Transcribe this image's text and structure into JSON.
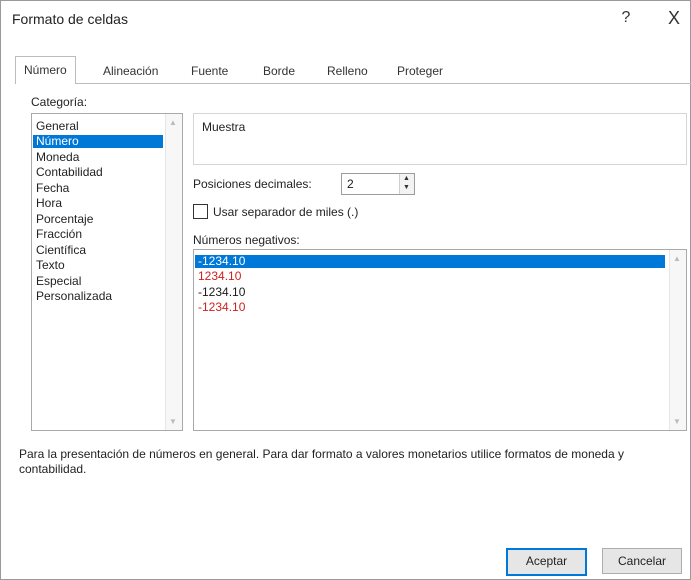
{
  "window": {
    "title": "Formato de celdas",
    "help": "?",
    "close": "X"
  },
  "tabs": [
    {
      "label": "Número",
      "active": true
    },
    {
      "label": "Alineación"
    },
    {
      "label": "Fuente"
    },
    {
      "label": "Borde"
    },
    {
      "label": "Relleno"
    },
    {
      "label": "Proteger"
    }
  ],
  "category": {
    "label": "Categoría:",
    "items": [
      "General",
      "Número",
      "Moneda",
      "Contabilidad",
      "Fecha",
      "Hora",
      "Porcentaje",
      "Fracción",
      "Científica",
      "Texto",
      "Especial",
      "Personalizada"
    ],
    "selected": "Número"
  },
  "sample": {
    "label": "Muestra",
    "value": ""
  },
  "decimals": {
    "label": "Posiciones decimales:",
    "value": "2"
  },
  "thousands": {
    "label": "Usar separador de miles (.)",
    "checked": false
  },
  "negatives": {
    "label": "Números negativos:",
    "items": [
      {
        "text": "-1234.10",
        "color": "#000000",
        "selected": true
      },
      {
        "text": "1234.10",
        "color": "#d02020"
      },
      {
        "text": "-1234.10",
        "color": "#000000"
      },
      {
        "text": "-1234.10",
        "color": "#d02020"
      }
    ]
  },
  "description": "Para la presentación de números en general. Para dar formato a valores monetarios utilice formatos de moneda y contabilidad.",
  "buttons": {
    "accept": "Aceptar",
    "cancel": "Cancelar"
  },
  "colors": {
    "selection": "#0078d7",
    "negative_red": "#d02020"
  }
}
